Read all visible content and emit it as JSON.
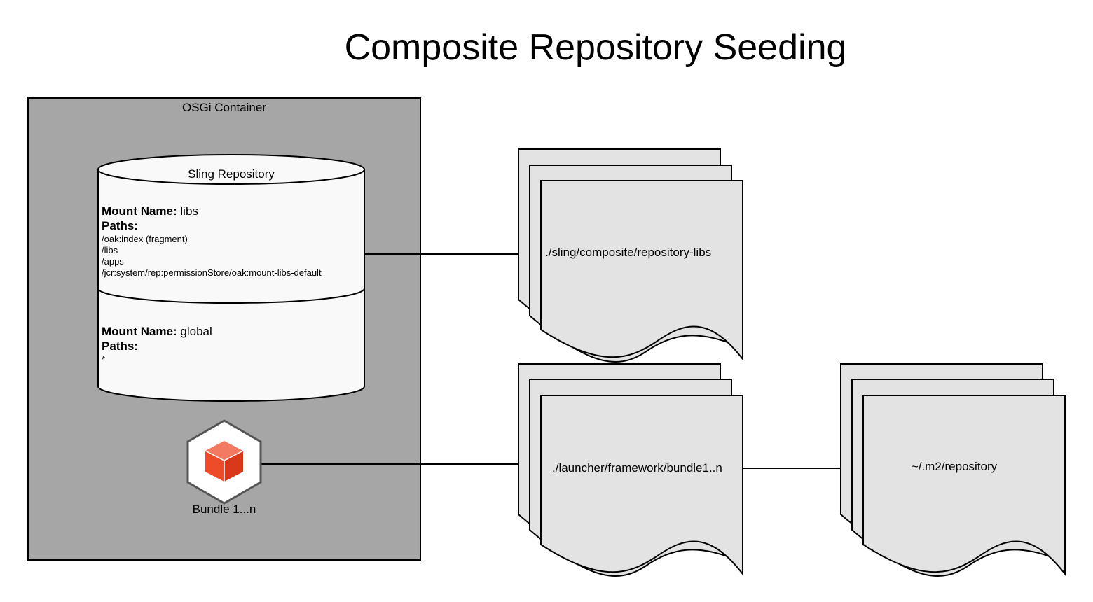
{
  "title": "Composite Repository Seeding",
  "container": {
    "label": "OSGi Container",
    "repository": {
      "label": "Sling Repository",
      "mounts": [
        {
          "mount_name_label": "Mount Name:",
          "mount_name_value": "libs",
          "paths_label": "Paths:",
          "paths": [
            "/oak:index (fragment)",
            "/libs",
            "/apps",
            "/jcr:system/rep:permissionStore/oak:mount-libs-default"
          ]
        },
        {
          "mount_name_label": "Mount Name:",
          "mount_name_value": "global",
          "paths_label": "Paths:",
          "paths": [
            "*"
          ]
        }
      ]
    },
    "bundle": {
      "label": "Bundle 1...n",
      "icon": "bundle-cube-icon"
    }
  },
  "documents": {
    "repository_libs": "./sling/composite/repository-libs",
    "launcher_bundles": "./launcher/framework/bundle1..n",
    "maven_repo": "~/.m2/repository"
  },
  "colors": {
    "container_fill": "#a6a6a6",
    "repository_fill": "#f9f9f9",
    "document_fill": "#e3e3e3",
    "cube_accent": "#ee4b2b",
    "stroke": "#000000"
  }
}
